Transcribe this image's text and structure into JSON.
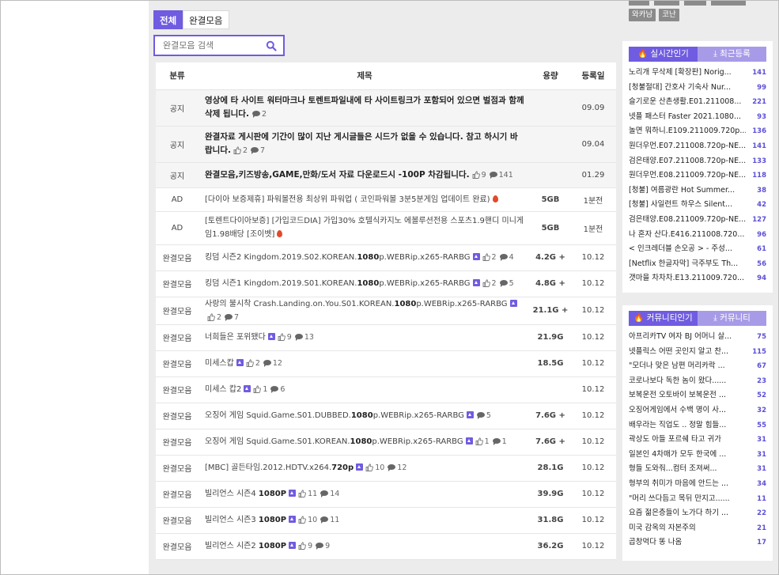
{
  "tabs": [
    {
      "label": "전체"
    },
    {
      "label": "완결모음"
    }
  ],
  "search": {
    "placeholder": "완결모음 검색"
  },
  "table": {
    "headers": {
      "category": "분류",
      "title": "제목",
      "size": "용량",
      "date": "등록일"
    },
    "rows": [
      {
        "type": "notice",
        "category": "공지",
        "title": "영상에 타 사이트 워터마크나 토렌트파일내에 타 사이트링크가 포함되어 있으면 벌점과 함께 삭제 됩니다.",
        "comments": "2",
        "size": "",
        "date": "09.09"
      },
      {
        "type": "notice",
        "category": "공지",
        "title": "완결자료 게시판에 기간이 많이 지난 게시글들은 시드가 없을 수 있습니다. 참고 하시기 바랍니다.",
        "likes": "2",
        "comments": "7",
        "size": "",
        "date": "09.04"
      },
      {
        "type": "notice",
        "category": "공지",
        "title": "완결모음,키즈방송,GAME,만화/도서 자료 다운로드시 -100P 차감됩니다.",
        "likes": "9",
        "comments": "141",
        "size": "",
        "date": "01.29"
      },
      {
        "type": "ad",
        "category": "AD",
        "title": "[다이아 보증제휴] 파워볼전용 최상위 파워업 ( 코인파워볼 3분5분게임 업데이트 완료)",
        "size": "5GB",
        "date": "1분전"
      },
      {
        "type": "ad",
        "category": "AD",
        "title": "[토렌트다이아보증] [가입코드DIA] 가입30% 호텔식카지노 에볼루션전용 스포츠1.9핸디 미니게임1.98배당 [조이벳]",
        "size": "5GB",
        "date": "1분전"
      },
      {
        "category": "완결모음",
        "title_pre": "킹덤 시즌2 Kingdom.2019.S02.KOREAN.",
        "title_bold": "1080",
        "title_post": "p.WEBRip.x265-RARBG",
        "likes": "2",
        "comments": "4",
        "size": "4.2G +",
        "date": "10.12"
      },
      {
        "category": "완결모음",
        "title_pre": "킹덤 시즌1 Kingdom.2019.S01.KOREAN.",
        "title_bold": "1080",
        "title_post": "p.WEBRip.x265-RARBG",
        "likes": "2",
        "comments": "5",
        "size": "4.8G +",
        "date": "10.12"
      },
      {
        "category": "완결모음",
        "title_pre": "사랑의 불시착 Crash.Landing.on.You.S01.KOREAN.",
        "title_bold": "1080",
        "title_post": "p.WEBRip.x265-RARBG",
        "likes": "2",
        "comments": "7",
        "size": "21.1G +",
        "date": "10.12"
      },
      {
        "category": "완결모음",
        "title_pre": "너희들은 포위됐다",
        "title_bold": "",
        "title_post": "",
        "likes": "9",
        "comments": "13",
        "size": "21.9G",
        "date": "10.12"
      },
      {
        "category": "완결모음",
        "title_pre": "미세스캅",
        "title_bold": "",
        "title_post": "",
        "likes": "2",
        "comments": "12",
        "size": "18.5G",
        "date": "10.12"
      },
      {
        "category": "완결모음",
        "title_pre": "미세스 캅2",
        "title_bold": "",
        "title_post": "",
        "likes": "1",
        "comments": "6",
        "size": "",
        "date": "10.12"
      },
      {
        "category": "완결모음",
        "title_pre": "오징어 게임 Squid.Game.S01.DUBBED.",
        "title_bold": "1080",
        "title_post": "p.WEBRip.x265-RARBG",
        "likes": "",
        "comments": "5",
        "size": "7.6G +",
        "date": "10.12"
      },
      {
        "category": "완결모음",
        "title_pre": "오징어 게임 Squid.Game.S01.KOREAN.",
        "title_bold": "1080",
        "title_post": "p.WEBRip.x265-RARBG",
        "likes": "1",
        "comments": "1",
        "size": "7.6G +",
        "date": "10.12"
      },
      {
        "category": "완결모음",
        "title_pre": "[MBC] 골든타임.2012.HDTV.x264.",
        "title_bold": "720p",
        "title_post": "",
        "likes": "10",
        "comments": "12",
        "size": "28.1G",
        "date": "10.12"
      },
      {
        "category": "완결모음",
        "title_pre": "빌리언스 시즌4 ",
        "title_bold": "1080P",
        "title_post": "",
        "likes": "11",
        "comments": "14",
        "size": "39.9G",
        "date": "10.12"
      },
      {
        "category": "완결모음",
        "title_pre": "빌리언스 시즌3 ",
        "title_bold": "1080P",
        "title_post": "",
        "likes": "10",
        "comments": "11",
        "size": "31.8G",
        "date": "10.12"
      },
      {
        "category": "완결모음",
        "title_pre": "빌리언스 시즌2 ",
        "title_bold": "1080P",
        "title_post": "",
        "likes": "9",
        "comments": "9",
        "size": "36.2G",
        "date": "10.12"
      }
    ]
  },
  "sidebar": {
    "chips": [
      {
        "label": "와카남"
      },
      {
        "label": "코난"
      }
    ],
    "popular": {
      "tabs": [
        {
          "label": "실시간인기"
        },
        {
          "label": "최근등록"
        }
      ],
      "items": [
        {
          "title": "노리개 무삭제 [확장판] Norig...",
          "count": "141"
        },
        {
          "title": "[청불절대] 간호사 기숙사 Nur...",
          "count": "99"
        },
        {
          "title": "슬기로운 산촌생활.E01.211008...",
          "count": "221"
        },
        {
          "title": "넷플 패스터 Faster 2021.1080...",
          "count": "93"
        },
        {
          "title": "놀면 뭐하니.E109.211009.720p...",
          "count": "136"
        },
        {
          "title": "원더우먼.E07.211008.720p-NE...",
          "count": "141"
        },
        {
          "title": "검은태양.E07.211008.720p-NE...",
          "count": "133"
        },
        {
          "title": "원더우먼.E08.211009.720p-NE...",
          "count": "118"
        },
        {
          "title": "[청불] 여름광란 Hot Summer...",
          "count": "38"
        },
        {
          "title": "[청불] 사일런트 하우스 Silent...",
          "count": "42"
        },
        {
          "title": "검은태양.E08.211009.720p-NE...",
          "count": "127"
        },
        {
          "title": "나 혼자 산다.E416.211008.720...",
          "count": "96"
        },
        {
          "title": "< 인크레더블 손오공 > - 주성...",
          "count": "61"
        },
        {
          "title": "[Netflix 한글자막] 극주부도 Th...",
          "count": "56"
        },
        {
          "title": "갯마을 차차차.E13.211009.720...",
          "count": "94"
        }
      ]
    },
    "community": {
      "tabs": [
        {
          "label": "커뮤니티인기"
        },
        {
          "label": "커뮤니티"
        }
      ],
      "items": [
        {
          "title": "아프리카TV 여자 BJ 어머니 살...",
          "count": "75"
        },
        {
          "title": "넷플릭스 어떤 곳인지 알고 찬...",
          "count": "115"
        },
        {
          "title": "\"모더나 맞은 남편 머리카락 ...",
          "count": "67"
        },
        {
          "title": "코로나보다 독한 놈이 왔다......",
          "count": "23"
        },
        {
          "title": "보복운전 오토바이 보복운전 ...",
          "count": "52"
        },
        {
          "title": "오징어게임에서 수백 명이 사...",
          "count": "32"
        },
        {
          "title": "배우라는 직업도 .. 정말 힘들...",
          "count": "55"
        },
        {
          "title": "곽상도 아들 포르쉐 타고 귀가",
          "count": "31"
        },
        {
          "title": "일본인 4차매가 모두 한국에 ...",
          "count": "31"
        },
        {
          "title": "형들 도와줘...컴터 조져써...",
          "count": "31"
        },
        {
          "title": "형부의 취미가 마음에 안드는 ...",
          "count": "34"
        },
        {
          "title": "\"머리 쓰다듬고 목뒤 만지고......",
          "count": "11"
        },
        {
          "title": "요즘 젊은층들이 노가다 하기 ...",
          "count": "22"
        },
        {
          "title": "미국 감옥의 자본주의",
          "count": "21"
        },
        {
          "title": "곱창먹다 똥 나옴",
          "count": "17"
        }
      ]
    }
  }
}
